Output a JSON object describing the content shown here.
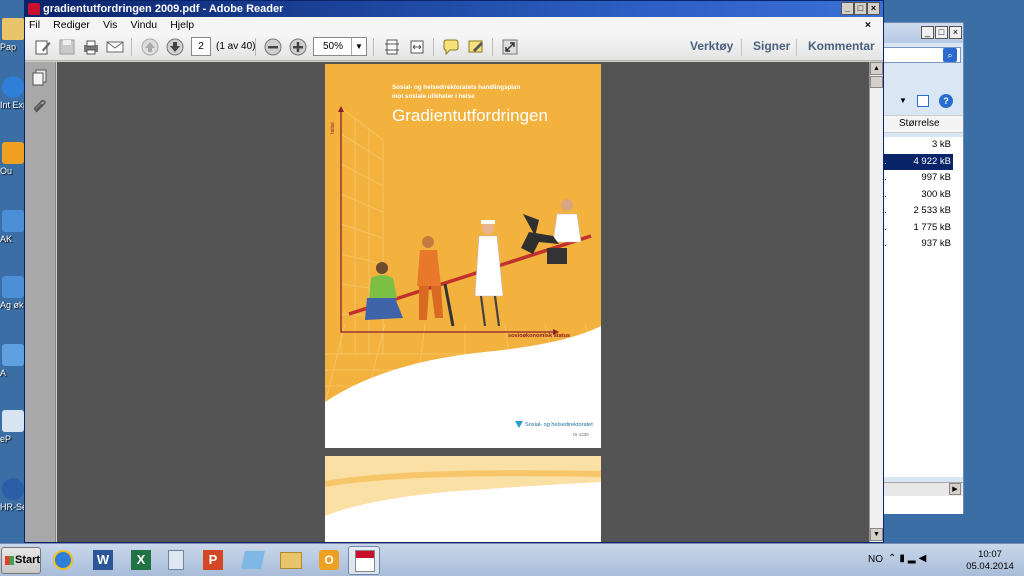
{
  "reader": {
    "title": "gradientutfordringen 2009.pdf - Adobe Reader",
    "menu": [
      "Fil",
      "Rediger",
      "Vis",
      "Vindu",
      "Hjelp"
    ],
    "close_doc": "×",
    "page_current": "2",
    "page_of": "(1 av 40)",
    "zoom": "50%",
    "links": {
      "tools": "Verktøy",
      "sign": "Signer",
      "comment": "Kommentar"
    }
  },
  "cover": {
    "subtitle_line1": "Sosial- og helsedirektoratets handlingsplan",
    "subtitle_line2": "mot sosiale ulikheter i helse",
    "title": "Gradientutfordringen",
    "y_label": "helse",
    "x_label": "sosioøkonomisk status",
    "publisher": "Sosial- og helsedirektoratet",
    "code": "IS-1230"
  },
  "explorer": {
    "column_header": "Størrelse",
    "file_sizes": [
      "3 kB",
      "4 922 kB",
      "997 kB",
      "300 kB",
      "2 533 kB",
      "1 775 kB",
      "937 kB"
    ],
    "selected_index": 1
  },
  "desktop_icons": [
    "Pap",
    "Int Exp",
    "Ou",
    "AK",
    "Ag økon",
    "A",
    "eP",
    "HR-Se"
  ],
  "taskbar": {
    "start": "Start",
    "language": "NO",
    "time": "10:07",
    "date": "05.04.2014"
  },
  "colors": {
    "cover_orange": "#f3b23e",
    "axis_red": "#8b1e2b",
    "titlebar_blue": "#0a246a",
    "doc_background": "#545454"
  }
}
